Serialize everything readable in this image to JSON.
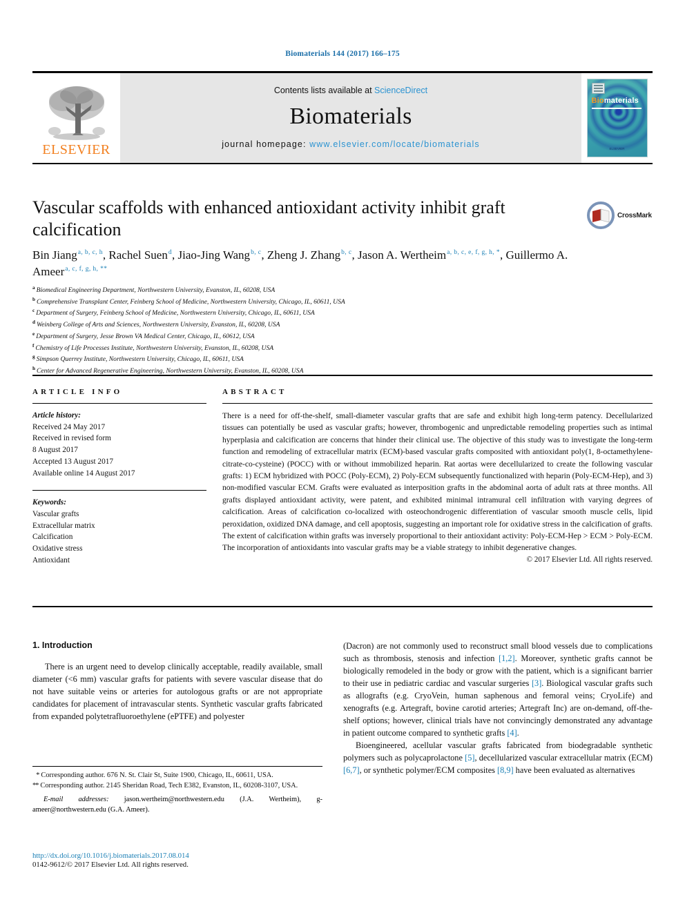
{
  "running_head": "Biomaterials 144 (2017) 166–175",
  "masthead": {
    "publisher_name": "ELSEVIER",
    "contents_prefix": "Contents lists available at",
    "contents_link": "ScienceDirect",
    "journal_title": "Biomaterials",
    "homepage_prefix": "journal homepage:",
    "homepage_url": "www.elsevier.com/locate/biomaterials",
    "cover_title_bio": "Bio",
    "cover_title_rest": "materials",
    "cover_footer": "ELSEVIER"
  },
  "article": {
    "title": "Vascular scaffolds with enhanced antioxidant activity inhibit graft calcification",
    "crossmark_label": "CrossMark"
  },
  "authors": [
    {
      "name": "Bin Jiang",
      "sup": "a, b, c, h",
      "sep": ", "
    },
    {
      "name": "Rachel Suen",
      "sup": "d",
      "sep": ", "
    },
    {
      "name": "Jiao-Jing Wang",
      "sup": "b, c",
      "sep": ", "
    },
    {
      "name": "Zheng J. Zhang",
      "sup": "b, c",
      "sep": ", "
    },
    {
      "name": "Jason A. Wertheim",
      "sup": "a, b, c, e, f, g, h, *",
      "sep": ", "
    },
    {
      "name": "Guillermo A. Ameer",
      "sup": "a, c, f, g, h, **",
      "sep": ""
    }
  ],
  "affiliations": [
    {
      "mark": "a",
      "text": "Biomedical Engineering Department, Northwestern University, Evanston, IL, 60208, USA"
    },
    {
      "mark": "b",
      "text": "Comprehensive Transplant Center, Feinberg School of Medicine, Northwestern University, Chicago, IL, 60611, USA"
    },
    {
      "mark": "c",
      "text": "Department of Surgery, Feinberg School of Medicine, Northwestern University, Chicago, IL, 60611, USA"
    },
    {
      "mark": "d",
      "text": "Weinberg College of Arts and Sciences, Northwestern University, Evanston, IL, 60208, USA"
    },
    {
      "mark": "e",
      "text": "Department of Surgery, Jesse Brown VA Medical Center, Chicago, IL, 60612, USA"
    },
    {
      "mark": "f",
      "text": "Chemistry of Life Processes Institute, Northwestern University, Evanston, IL, 60208, USA"
    },
    {
      "mark": "g",
      "text": "Simpson Querrey Institute, Northwestern University, Chicago, IL, 60611, USA"
    },
    {
      "mark": "h",
      "text": "Center for Advanced Regenerative Engineering, Northwestern University, Evanston, IL, 60208, USA"
    }
  ],
  "article_info": {
    "heading": "ARTICLE INFO",
    "history_label": "Article history:",
    "history": [
      "Received 24 May 2017",
      "Received in revised form",
      "8 August 2017",
      "Accepted 13 August 2017",
      "Available online 14 August 2017"
    ],
    "keywords_label": "Keywords:",
    "keywords": [
      "Vascular grafts",
      "Extracellular matrix",
      "Calcification",
      "Oxidative stress",
      "Antioxidant"
    ]
  },
  "abstract": {
    "heading": "ABSTRACT",
    "text": "There is a need for off-the-shelf, small-diameter vascular grafts that are safe and exhibit high long-term patency. Decellularized tissues can potentially be used as vascular grafts; however, thrombogenic and unpredictable remodeling properties such as intimal hyperplasia and calcification are concerns that hinder their clinical use. The objective of this study was to investigate the long-term function and remodeling of extracellular matrix (ECM)-based vascular grafts composited with antioxidant poly(1, 8-octamethylene-citrate-co-cysteine) (POCC) with or without immobilized heparin. Rat aortas were decellularized to create the following vascular grafts: 1) ECM hybridized with POCC (Poly-ECM), 2) Poly-ECM subsequently functionalized with heparin (Poly-ECM-Hep), and 3) non-modified vascular ECM. Grafts were evaluated as interposition grafts in the abdominal aorta of adult rats at three months. All grafts displayed antioxidant activity, were patent, and exhibited minimal intramural cell infiltration with varying degrees of calcification. Areas of calcification co-localized with osteochondrogenic differentiation of vascular smooth muscle cells, lipid peroxidation, oxidized DNA damage, and cell apoptosis, suggesting an important role for oxidative stress in the calcification of grafts. The extent of calcification within grafts was inversely proportional to their antioxidant activity: Poly-ECM-Hep > ECM > Poly-ECM. The incorporation of antioxidants into vascular grafts may be a viable strategy to inhibit degenerative changes.",
    "copyright": "© 2017 Elsevier Ltd. All rights reserved."
  },
  "introduction": {
    "heading": "1. Introduction",
    "left_paragraph": "There is an urgent need to develop clinically acceptable, readily available, small diameter (<6 mm) vascular grafts for patients with severe vascular disease that do not have suitable veins or arteries for autologous grafts or are not appropriate candidates for placement of intravascular stents. Synthetic vascular grafts fabricated from expanded polytetrafluoroethylene (ePTFE) and polyester",
    "right_paragraph_1_a": "(Dacron) are not commonly used to reconstruct small blood vessels due to complications such as thrombosis, stenosis and infection ",
    "right_paragraph_1_ref1": "[1,2]",
    "right_paragraph_1_b": ". Moreover, synthetic grafts cannot be biologically remodeled in the body or grow with the patient, which is a significant barrier to their use in pediatric cardiac and vascular surgeries ",
    "right_paragraph_1_ref2": "[3]",
    "right_paragraph_1_c": ". Biological vascular grafts such as allografts (e.g. CryoVein, human saphenous and femoral veins; CryoLife) and xenografts (e.g. Artegraft, bovine carotid arteries; Artegraft Inc) are on-demand, off-the-shelf options; however, clinical trials have not convincingly demonstrated any advantage in patient outcome compared to synthetic grafts ",
    "right_paragraph_1_ref3": "[4]",
    "right_paragraph_1_d": ".",
    "right_paragraph_2_a": "Bioengineered, acellular vascular grafts fabricated from biodegradable synthetic polymers such as polycaprolactone ",
    "right_paragraph_2_ref1": "[5]",
    "right_paragraph_2_b": ", decellularized vascular extracellular matrix (ECM) ",
    "right_paragraph_2_ref2": "[6,7]",
    "right_paragraph_2_c": ", or synthetic polymer/ECM composites ",
    "right_paragraph_2_ref3": "[8,9]",
    "right_paragraph_2_d": " have been evaluated as alternatives"
  },
  "footnotes": {
    "corr1_mark": "*",
    "corr1": "Corresponding author. 676 N. St. Clair St, Suite 1900, Chicago, IL, 60611, USA.",
    "corr2_mark": "**",
    "corr2": "Corresponding author. 2145 Sheridan Road, Tech E382, Evanston, IL, 60208-3107, USA.",
    "email_label": "E-mail addresses:",
    "email1": "jason.wertheim@northwestern.edu",
    "email1_owner": "(J.A. Wertheim)",
    "email2": "g-ameer@northwestern.edu",
    "email2_owner": "(G.A. Ameer)."
  },
  "doi": {
    "url": "http://dx.doi.org/10.1016/j.biomaterials.2017.08.014",
    "issn_line": "0142-9612/© 2017 Elsevier Ltd. All rights reserved."
  },
  "colors": {
    "link_blue": "#1a7fb5",
    "sciencedirect_blue": "#2b93d1",
    "elsevier_orange": "#f28020"
  }
}
